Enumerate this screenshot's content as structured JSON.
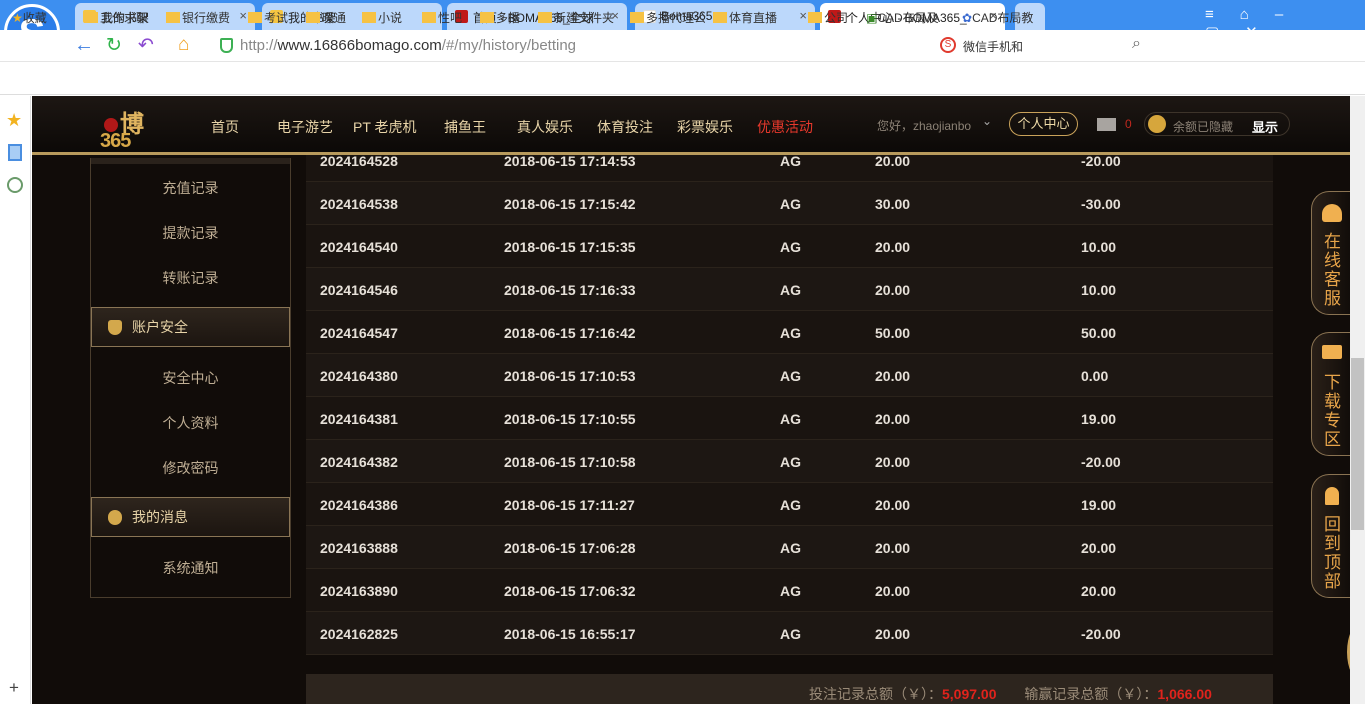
{
  "browser": {
    "tabs": [
      {
        "label": "我的书架"
      },
      {
        "label": "我的书架"
      },
      {
        "label": "首页 - BOMA365_全球"
      },
      {
        "label": "Boma365"
      },
      {
        "label": "个人中心 - BOMA365_"
      }
    ],
    "url_prefix": "http://",
    "url_host": "www.16866bomago.com",
    "url_path": "/#/my/history/betting",
    "search_text": "微信手机和",
    "bookmarks": [
      "收藏",
      "工作求职",
      "银行缴费",
      "考试",
      "暖通",
      "小说",
      "性吧",
      "多播",
      "新建文件夹",
      "多播代理公",
      "体育直播",
      "公司",
      "CAD布局及",
      "CAD布局教"
    ]
  },
  "site": {
    "nav": [
      "首页",
      "电子游艺",
      "PT 老虎机",
      "捕鱼王",
      "真人娱乐",
      "体育投注",
      "彩票娱乐",
      "优惠活动"
    ],
    "greeting": "您好，zhaojianbo",
    "center_btn": "个人中心",
    "mail_count": "0",
    "balance_hidden": "余额已隐藏",
    "show_btn": "显示",
    "sidebar": {
      "items_a": [
        "充值记录",
        "提款记录",
        "转账记录"
      ],
      "head_security": "账户安全",
      "items_b": [
        "安全中心",
        "个人资料",
        "修改密码"
      ],
      "head_msg": "我的消息",
      "items_c": [
        "系统通知"
      ]
    },
    "rows": [
      [
        "2024164528",
        "2018-06-15 17:14:53",
        "AG",
        "20.00",
        "-20.00"
      ],
      [
        "2024164538",
        "2018-06-15 17:15:42",
        "AG",
        "30.00",
        "-30.00"
      ],
      [
        "2024164540",
        "2018-06-15 17:15:35",
        "AG",
        "20.00",
        "10.00"
      ],
      [
        "2024164546",
        "2018-06-15 17:16:33",
        "AG",
        "20.00",
        "10.00"
      ],
      [
        "2024164547",
        "2018-06-15 17:16:42",
        "AG",
        "50.00",
        "50.00"
      ],
      [
        "2024164380",
        "2018-06-15 17:10:53",
        "AG",
        "20.00",
        "0.00"
      ],
      [
        "2024164381",
        "2018-06-15 17:10:55",
        "AG",
        "20.00",
        "19.00"
      ],
      [
        "2024164382",
        "2018-06-15 17:10:58",
        "AG",
        "20.00",
        "-20.00"
      ],
      [
        "2024164386",
        "2018-06-15 17:11:27",
        "AG",
        "20.00",
        "19.00"
      ],
      [
        "2024163888",
        "2018-06-15 17:06:28",
        "AG",
        "20.00",
        "20.00"
      ],
      [
        "2024163890",
        "2018-06-15 17:06:32",
        "AG",
        "20.00",
        "20.00"
      ],
      [
        "2024162825",
        "2018-06-15 16:55:17",
        "AG",
        "20.00",
        "-20.00"
      ]
    ],
    "footer": {
      "bet_label": "投注记录总额（￥）：",
      "bet_total": "5,097.00",
      "win_label": "输赢记录总额（￥）：",
      "win_total": "1,066.00"
    },
    "float": [
      "在线客服",
      "下载专区",
      "回到顶部"
    ]
  }
}
